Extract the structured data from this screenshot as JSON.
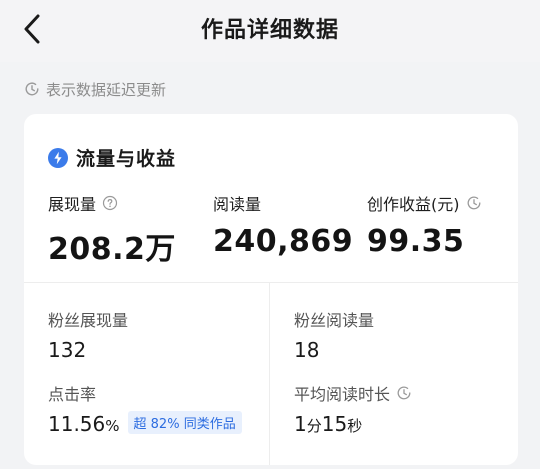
{
  "header": {
    "title": "作品详细数据"
  },
  "notice": {
    "text": "表示数据延迟更新"
  },
  "card": {
    "title": "流量与收益",
    "metrics": [
      {
        "label": "展现量",
        "value": "208.2万"
      },
      {
        "label": "阅读量",
        "value": "240,869"
      },
      {
        "label": "创作收益(元)",
        "value": "99.35"
      }
    ],
    "fans_impressions": {
      "label": "粉丝展现量",
      "value": "132"
    },
    "fans_reads": {
      "label": "粉丝阅读量",
      "value": "18"
    },
    "ctr": {
      "label": "点击率",
      "value": "11.56",
      "unit": "%",
      "badge": "超 82% 同类作品"
    },
    "avg_read_time": {
      "label": "平均阅读时长",
      "value_min": "1",
      "unit_min": "分",
      "value_sec": "15",
      "unit_sec": "秒"
    }
  },
  "icons": {
    "back": "chevron-left-icon",
    "delay": "clock-icon",
    "section": "bolt-icon",
    "help": "question-icon",
    "refresh": "refresh-icon"
  },
  "colors": {
    "accent": "#3b7bea",
    "badge_bg": "#e8f0fd",
    "badge_text": "#2c6ce0"
  }
}
